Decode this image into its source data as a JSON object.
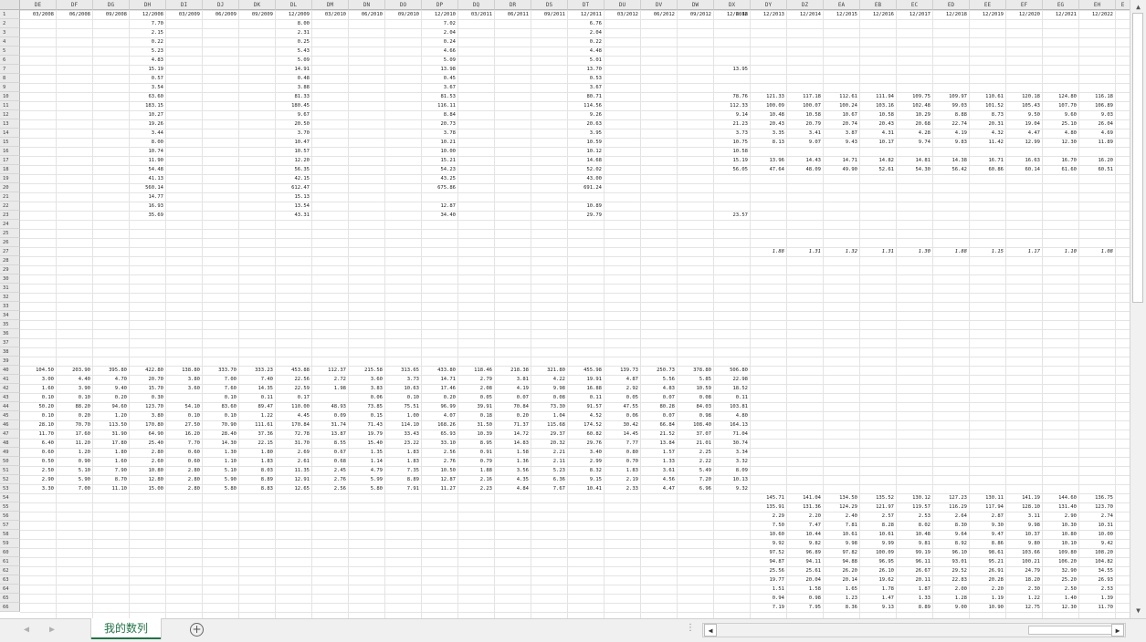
{
  "sheet": {
    "columns": [
      {
        "letter": "DE",
        "date": "03/2008"
      },
      {
        "letter": "DF",
        "date": "06/2008"
      },
      {
        "letter": "DG",
        "date": "09/2008"
      },
      {
        "letter": "DH",
        "date": "12/2008"
      },
      {
        "letter": "DI",
        "date": "03/2009"
      },
      {
        "letter": "DJ",
        "date": "06/2009"
      },
      {
        "letter": "DK",
        "date": "09/2009"
      },
      {
        "letter": "DL",
        "date": "12/2009"
      },
      {
        "letter": "DM",
        "date": "03/2010"
      },
      {
        "letter": "DN",
        "date": "06/2010"
      },
      {
        "letter": "DO",
        "date": "09/2010"
      },
      {
        "letter": "DP",
        "date": "12/2010"
      },
      {
        "letter": "DQ",
        "date": "03/2011"
      },
      {
        "letter": "DR",
        "date": "06/2011"
      },
      {
        "letter": "DS",
        "date": "09/2011"
      },
      {
        "letter": "DT",
        "date": "12/2011"
      },
      {
        "letter": "DU",
        "date": "03/2012"
      },
      {
        "letter": "DV",
        "date": "06/2012"
      },
      {
        "letter": "DW",
        "date": "09/2012"
      },
      {
        "letter": "DX",
        "date": "12/2012"
      },
      {
        "letter": "DY",
        "date": "12/2013"
      },
      {
        "letter": "DZ",
        "date": "12/2014"
      },
      {
        "letter": "EA",
        "date": "12/2015"
      },
      {
        "letter": "EB",
        "date": "12/2016"
      },
      {
        "letter": "EC",
        "date": "12/2017"
      },
      {
        "letter": "ED",
        "date": "12/2018"
      },
      {
        "letter": "EE",
        "date": "12/2019"
      },
      {
        "letter": "EF",
        "date": "12/2020"
      },
      {
        "letter": "EG",
        "date": "12/2021"
      },
      {
        "letter": "EH",
        "date": "12/2022"
      },
      {
        "letter": "E",
        "date": ""
      }
    ],
    "row_numbers": [
      "1",
      "2",
      "3",
      "4",
      "5",
      "6",
      "7",
      "8",
      "9",
      "10",
      "11",
      "12",
      "13",
      "14",
      "15",
      "16",
      "17",
      "18",
      "19",
      "20",
      "21",
      "22",
      "23",
      "24",
      "25",
      "26",
      "27",
      "28",
      "29",
      "30",
      "31",
      "32",
      "33",
      "34",
      "35",
      "36",
      "37",
      "38",
      "39",
      "40",
      "41",
      "42",
      "43",
      "44",
      "45",
      "46",
      "47",
      "48",
      "49",
      "50",
      "51",
      "52",
      "53",
      "54",
      "55",
      "56",
      "57",
      "58",
      "59",
      "60",
      "61",
      "62",
      "63",
      "64",
      "65",
      "66"
    ],
    "col_groups": {
      "dh": [
        "7.70",
        "2.15",
        "0.22",
        "5.23",
        "4.83",
        "15.19",
        "0.57",
        "3.54",
        "63.60",
        "183.15",
        "10.27",
        "19.26",
        "3.44",
        "8.00",
        "10.74",
        "11.90",
        "54.48",
        "41.13",
        "560.14",
        "14.77",
        "16.93",
        "35.69"
      ],
      "dl": [
        "8.00",
        "2.31",
        "0.25",
        "5.43",
        "5.09",
        "14.91",
        "0.48",
        "3.88",
        "81.33",
        "180.45",
        "9.67",
        "20.50",
        "3.70",
        "10.47",
        "10.57",
        "12.20",
        "56.35",
        "42.15",
        "612.47",
        "15.13",
        "13.54",
        "43.31"
      ],
      "dp": [
        "7.02",
        "2.04",
        "0.24",
        "4.66",
        "5.09",
        "13.98",
        "0.45",
        "3.67",
        "81.53",
        "116.11",
        "8.84",
        "20.73",
        "3.78",
        "10.21",
        "10.00",
        "15.21",
        "54.23",
        "43.25",
        "675.86",
        "",
        "12.87",
        "34.40"
      ],
      "dt": [
        "6.76",
        "2.04",
        "0.22",
        "4.48",
        "5.01",
        "13.70",
        "0.53",
        "3.67",
        "80.71",
        "114.56",
        "9.26",
        "20.63",
        "3.95",
        "10.59",
        "10.12",
        "14.68",
        "52.02",
        "43.00",
        "691.24",
        "",
        "10.89",
        "29.79"
      ],
      "dx_top": {
        "r1": "6.88",
        "r7": "13.95",
        "r10": "78.76",
        "r11": "112.33",
        "r12": "9.14",
        "r13": "21.23",
        "r14": "3.73",
        "r15": "10.75",
        "r16": "10.58",
        "r17": "15.19",
        "r18": "56.05",
        "r23": "23.57"
      }
    },
    "block_late": {
      "r10": [
        "121.33",
        "117.18",
        "112.61",
        "111.94",
        "109.75",
        "109.97",
        "110.61",
        "120.18",
        "124.80",
        "116.18"
      ],
      "r11": [
        "100.09",
        "100.07",
        "100.24",
        "103.16",
        "102.48",
        "99.03",
        "101.52",
        "105.43",
        "107.70",
        "106.89"
      ],
      "r12": [
        "10.48",
        "10.58",
        "10.67",
        "10.58",
        "10.29",
        "8.88",
        "8.73",
        "9.50",
        "9.60",
        "9.03"
      ],
      "r13": [
        "20.43",
        "20.79",
        "20.74",
        "20.43",
        "20.68",
        "22.74",
        "20.31",
        "19.04",
        "25.10",
        "26.04"
      ],
      "r14": [
        "3.35",
        "3.41",
        "3.87",
        "4.31",
        "4.28",
        "4.19",
        "4.32",
        "4.47",
        "4.80",
        "4.69"
      ],
      "r15": [
        "8.13",
        "9.07",
        "9.43",
        "10.17",
        "9.74",
        "9.83",
        "11.42",
        "12.99",
        "12.30",
        "11.89"
      ],
      "r17": [
        "13.96",
        "14.43",
        "14.71",
        "14.82",
        "14.81",
        "14.38",
        "16.71",
        "16.63",
        "16.70",
        "16.20"
      ],
      "r18": [
        "47.64",
        "48.09",
        "49.90",
        "52.61",
        "54.30",
        "56.42",
        "60.86",
        "60.14",
        "61.60",
        "60.51"
      ],
      "r27": [
        "1.88",
        "1.31",
        "1.32",
        "1.31",
        "1.30",
        "1.88",
        "1.15",
        "1.17",
        "1.10",
        "1.08"
      ]
    },
    "block_mid": {
      "r40": [
        "104.50",
        "203.90",
        "395.80",
        "422.80",
        "138.80",
        "333.70",
        "333.23",
        "453.88",
        "112.37",
        "215.58",
        "313.65",
        "433.80",
        "118.46",
        "218.38",
        "321.80",
        "455.98",
        "139.73",
        "250.73",
        "378.80",
        "506.80"
      ],
      "r41": [
        "3.00",
        "4.40",
        "4.70",
        "20.70",
        "3.80",
        "7.00",
        "7.40",
        "22.56",
        "2.72",
        "3.60",
        "3.73",
        "14.71",
        "2.79",
        "3.81",
        "4.22",
        "19.91",
        "4.87",
        "5.56",
        "5.85",
        "22.98"
      ],
      "r42": [
        "1.60",
        "3.90",
        "9.40",
        "15.70",
        "3.60",
        "7.60",
        "14.35",
        "22.59",
        "1.98",
        "3.83",
        "10.63",
        "17.46",
        "2.08",
        "4.19",
        "9.98",
        "16.88",
        "2.92",
        "4.83",
        "10.59",
        "18.52"
      ],
      "r43": [
        "0.10",
        "0.10",
        "0.20",
        "0.30",
        "",
        "0.10",
        "0.11",
        "0.17",
        "",
        "0.06",
        "0.10",
        "0.20",
        "0.05",
        "0.07",
        "0.08",
        "0.11",
        "0.05",
        "0.07",
        "0.08",
        "0.11"
      ],
      "r44": [
        "50.20",
        "88.20",
        "94.60",
        "123.70",
        "54.10",
        "83.60",
        "89.47",
        "110.00",
        "48.93",
        "73.85",
        "75.51",
        "96.99",
        "39.91",
        "70.84",
        "73.30",
        "91.57",
        "47.55",
        "80.28",
        "84.03",
        "103.81"
      ],
      "r45": [
        "0.10",
        "0.20",
        "1.20",
        "3.80",
        "0.10",
        "0.10",
        "1.22",
        "4.45",
        "0.09",
        "0.15",
        "1.00",
        "4.07",
        "0.18",
        "0.20",
        "1.04",
        "4.52",
        "0.06",
        "0.07",
        "0.98",
        "4.80"
      ],
      "r46": [
        "28.10",
        "70.70",
        "113.50",
        "170.80",
        "27.50",
        "70.90",
        "111.61",
        "170.84",
        "31.74",
        "71.43",
        "114.10",
        "168.26",
        "31.50",
        "71.37",
        "115.68",
        "174.52",
        "30.42",
        "66.84",
        "108.40",
        "164.13"
      ],
      "r47": [
        "11.70",
        "17.60",
        "31.90",
        "64.90",
        "16.20",
        "28.40",
        "37.36",
        "72.78",
        "13.87",
        "19.79",
        "33.43",
        "65.93",
        "10.39",
        "14.72",
        "29.37",
        "60.82",
        "14.45",
        "21.52",
        "37.07",
        "71.04"
      ],
      "r48": [
        "6.40",
        "11.20",
        "17.80",
        "25.40",
        "7.70",
        "14.30",
        "22.15",
        "31.70",
        "8.55",
        "15.40",
        "23.22",
        "33.10",
        "8.95",
        "14.83",
        "20.32",
        "29.76",
        "7.77",
        "13.84",
        "21.01",
        "30.74"
      ],
      "r49": [
        "0.60",
        "1.20",
        "1.80",
        "2.80",
        "0.60",
        "1.30",
        "1.80",
        "2.69",
        "0.67",
        "1.35",
        "1.83",
        "2.56",
        "0.91",
        "1.58",
        "2.21",
        "3.40",
        "0.80",
        "1.57",
        "2.25",
        "3.34"
      ],
      "r50": [
        "0.50",
        "0.90",
        "1.60",
        "2.60",
        "0.60",
        "1.10",
        "1.83",
        "2.61",
        "0.68",
        "1.14",
        "1.83",
        "2.76",
        "0.79",
        "1.36",
        "2.11",
        "2.99",
        "0.70",
        "1.33",
        "2.22",
        "3.32"
      ],
      "r51": [
        "2.50",
        "5.10",
        "7.90",
        "10.80",
        "2.80",
        "5.10",
        "8.03",
        "11.35",
        "2.45",
        "4.79",
        "7.35",
        "10.50",
        "1.88",
        "3.56",
        "5.23",
        "8.32",
        "1.83",
        "3.61",
        "5.49",
        "8.09"
      ],
      "r52": [
        "2.90",
        "5.90",
        "8.70",
        "12.80",
        "2.80",
        "5.90",
        "8.89",
        "12.91",
        "2.76",
        "5.99",
        "8.89",
        "12.87",
        "2.16",
        "4.35",
        "6.36",
        "9.15",
        "2.19",
        "4.56",
        "7.20",
        "10.13"
      ],
      "r53": [
        "3.30",
        "7.00",
        "11.10",
        "15.00",
        "2.80",
        "5.80",
        "8.83",
        "12.65",
        "2.56",
        "5.80",
        "7.91",
        "11.27",
        "2.23",
        "4.84",
        "7.67",
        "10.41",
        "2.33",
        "4.47",
        "6.96",
        "9.32"
      ]
    },
    "block_bottom": {
      "r54": [
        "145.71",
        "141.04",
        "134.50",
        "135.52",
        "130.12",
        "127.23",
        "130.11",
        "141.19",
        "144.60",
        "136.75"
      ],
      "r55": [
        "135.91",
        "131.36",
        "124.29",
        "121.97",
        "119.57",
        "116.29",
        "117.94",
        "128.10",
        "131.40",
        "123.70"
      ],
      "r56": [
        "2.29",
        "2.20",
        "2.40",
        "2.57",
        "2.53",
        "2.64",
        "2.87",
        "3.11",
        "2.90",
        "2.74"
      ],
      "r57": [
        "7.50",
        "7.47",
        "7.81",
        "8.28",
        "8.02",
        "8.30",
        "9.30",
        "9.98",
        "10.30",
        "10.31"
      ],
      "r58": [
        "10.60",
        "10.44",
        "10.61",
        "10.61",
        "10.48",
        "9.64",
        "9.47",
        "10.37",
        "10.80",
        "10.00"
      ],
      "r59": [
        "9.92",
        "9.82",
        "9.98",
        "9.99",
        "9.81",
        "8.92",
        "8.86",
        "9.80",
        "10.10",
        "9.42"
      ],
      "r60": [
        "97.52",
        "96.89",
        "97.82",
        "100.09",
        "99.19",
        "96.10",
        "98.61",
        "103.66",
        "109.80",
        "108.20"
      ],
      "r61": [
        "94.87",
        "94.11",
        "94.88",
        "96.95",
        "96.11",
        "93.01",
        "95.21",
        "100.21",
        "106.20",
        "104.82"
      ],
      "r62": [
        "25.56",
        "25.61",
        "26.20",
        "26.10",
        "26.67",
        "29.52",
        "26.91",
        "24.79",
        "32.90",
        "34.55"
      ],
      "r63": [
        "19.77",
        "20.04",
        "20.14",
        "19.62",
        "20.11",
        "22.83",
        "20.28",
        "18.20",
        "25.20",
        "26.93"
      ],
      "r64": [
        "1.51",
        "1.58",
        "1.65",
        "1.78",
        "1.87",
        "2.00",
        "2.20",
        "2.30",
        "2.50",
        "2.53"
      ],
      "r65": [
        "0.94",
        "0.98",
        "1.23",
        "1.47",
        "1.33",
        "1.28",
        "1.19",
        "1.22",
        "1.40",
        "1.39"
      ],
      "r66": [
        "7.19",
        "7.95",
        "8.36",
        "9.13",
        "8.89",
        "9.00",
        "10.90",
        "12.75",
        "12.30",
        "11.70"
      ]
    }
  },
  "tabs": {
    "active_sheet": "我的数列",
    "add_icon": "plus-circle-icon"
  },
  "icons": {
    "nav_prev": "◀",
    "nav_next": "▶",
    "scroll_up": "▲",
    "scroll_down": "▼",
    "scroll_left": "◀",
    "scroll_right": "▶",
    "more": "⋮"
  },
  "colors": {
    "accent": "#217346"
  }
}
